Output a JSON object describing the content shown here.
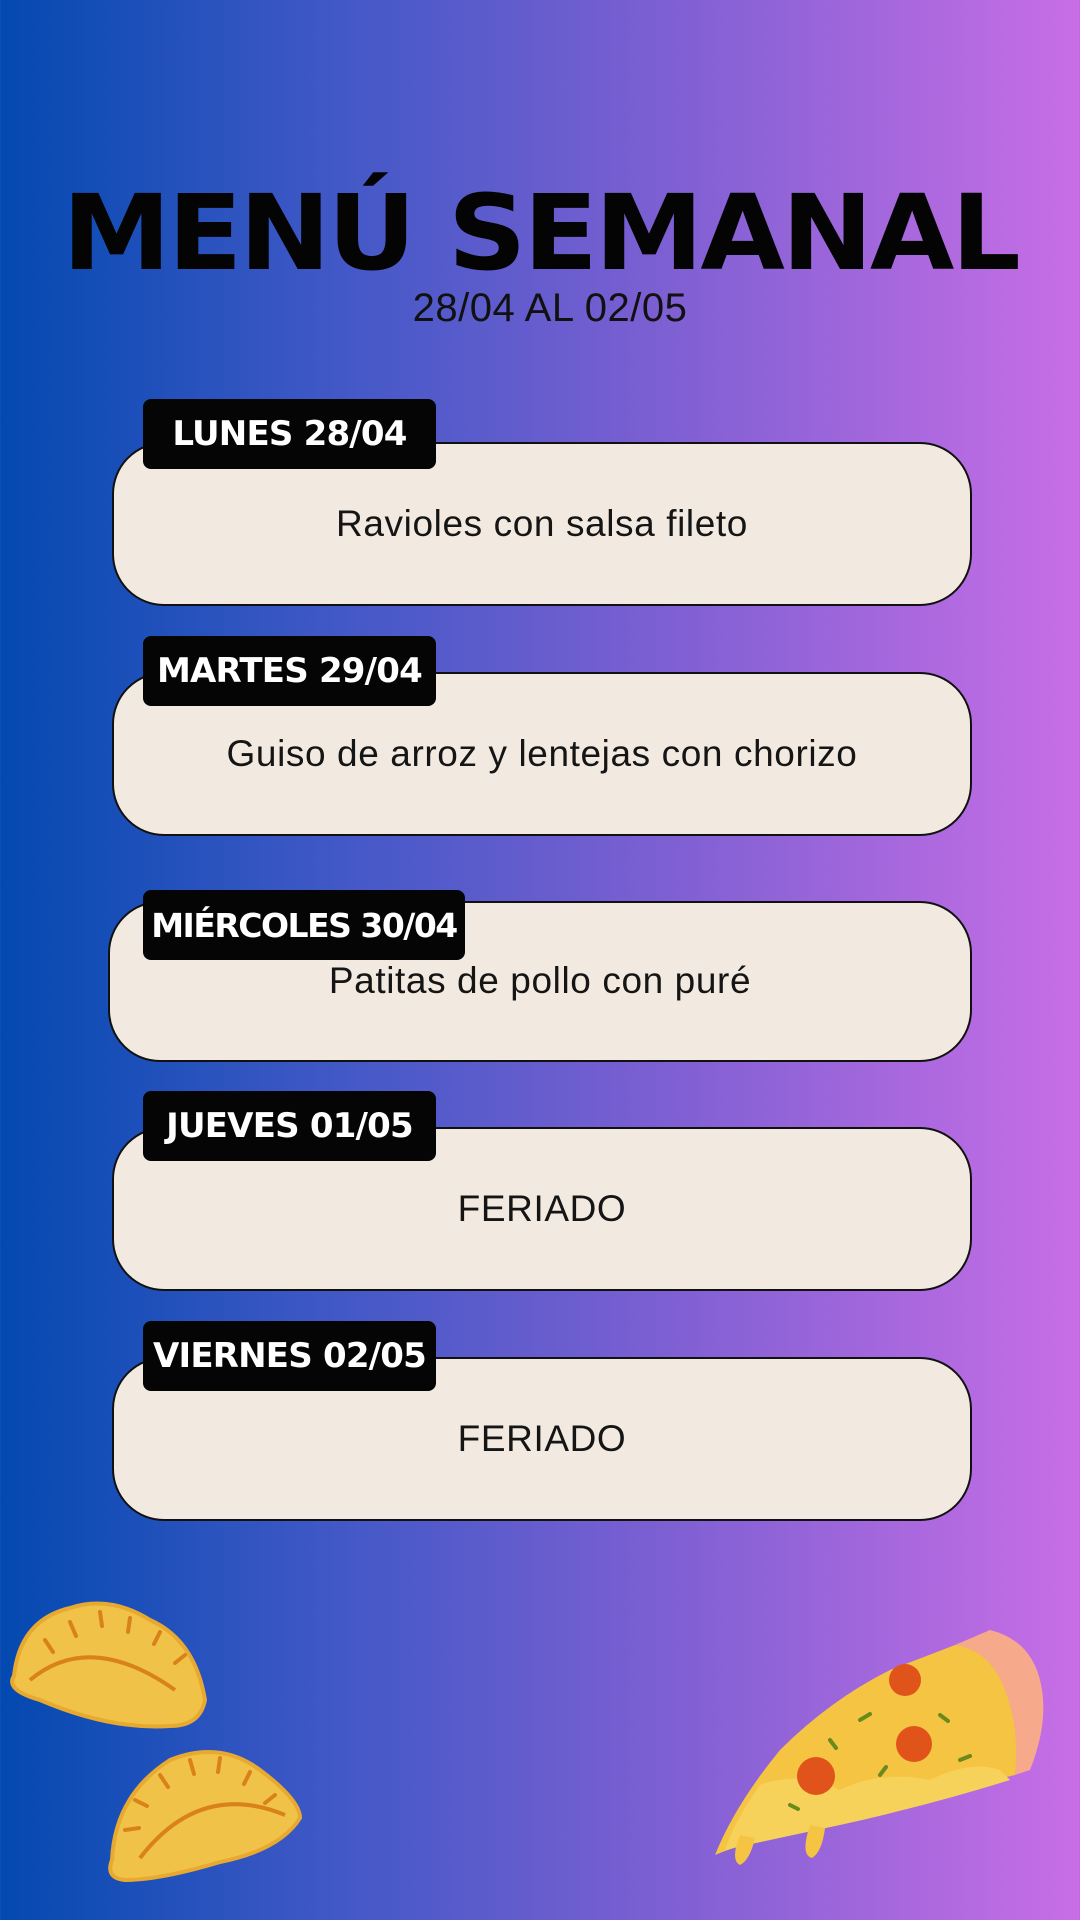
{
  "header": {
    "title": "MENÚ SEMANAL",
    "subtitle": "28/04 AL 02/05"
  },
  "days": [
    {
      "label": "LUNES 28/04",
      "dish": "Ravioles con salsa fileto"
    },
    {
      "label": "MARTES 29/04",
      "dish": "Guiso de arroz y lentejas con chorizo"
    },
    {
      "label": "MIÉRCOLES 30/04",
      "dish": "Patitas de pollo con puré"
    },
    {
      "label": "JUEVES 01/05",
      "dish": "FERIADO"
    },
    {
      "label": "VIERNES 02/05",
      "dish": "FERIADO"
    }
  ],
  "decorations": {
    "left": "empanada-illustration",
    "right": "pizza-slice-illustration"
  },
  "colors": {
    "gradient_left": "#0349b0",
    "gradient_right": "#c86ee6",
    "card_background": "#f2eae0",
    "tag_background": "#050505"
  }
}
